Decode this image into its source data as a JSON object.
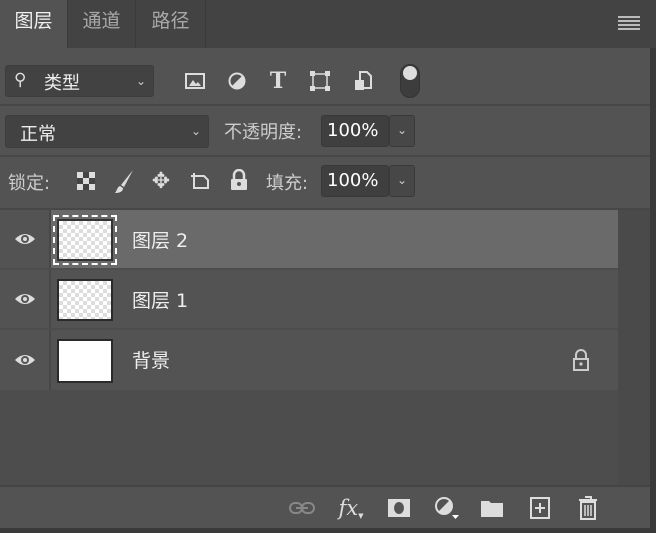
{
  "tabs": [
    {
      "label": "图层"
    },
    {
      "label": "通道"
    },
    {
      "label": "路径"
    }
  ],
  "filter": {
    "kind_label": "类型"
  },
  "blend": {
    "mode": "正常",
    "opacity_label": "不透明度:",
    "opacity": "100%"
  },
  "lock": {
    "label": "锁定:",
    "fill_label": "填充:",
    "fill": "100%"
  },
  "layers": [
    {
      "name": "图层 2",
      "selected": true,
      "visible": true,
      "locked": false,
      "thumb": "transparent"
    },
    {
      "name": "图层 1",
      "selected": false,
      "visible": true,
      "locked": false,
      "thumb": "transparent"
    },
    {
      "name": "背景",
      "selected": false,
      "visible": true,
      "locked": true,
      "thumb": "white"
    }
  ],
  "bottom": {
    "fx_label": "fx"
  }
}
